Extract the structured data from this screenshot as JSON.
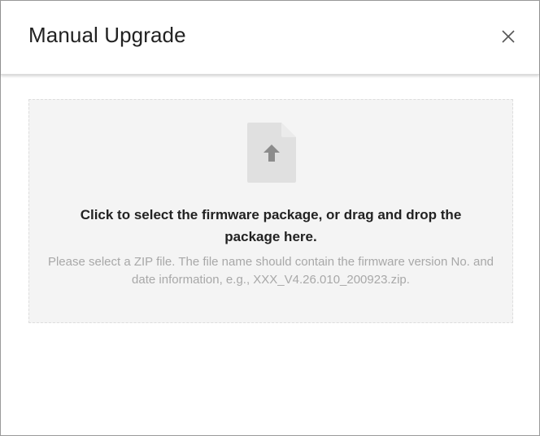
{
  "dialog": {
    "title": "Manual Upgrade",
    "close_icon": "close-icon"
  },
  "upload": {
    "icon": "file-upload-icon",
    "primary_text": "Click to select the firmware package, or drag and drop the package here.",
    "hint_text": "Please select a ZIP file. The file name should contain the firmware version No. and date information, e.g., XXX_V4.26.010_200923.zip."
  },
  "colors": {
    "dropzone_bg": "#f4f4f4",
    "icon_bg": "#e0e0e0",
    "icon_arrow": "#8c8c8c",
    "hint_text": "#a8a8a8"
  }
}
